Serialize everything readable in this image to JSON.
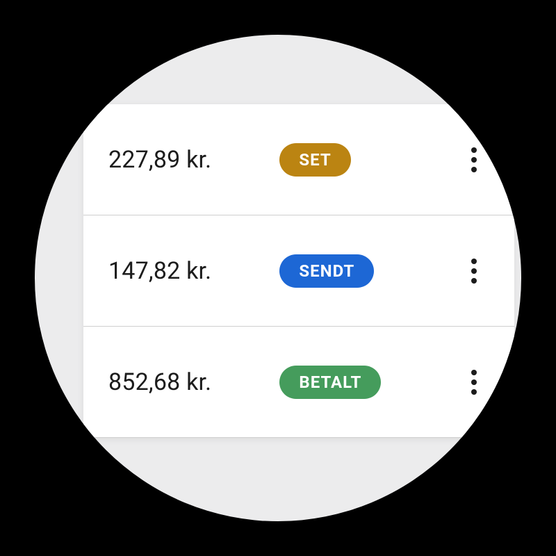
{
  "colors": {
    "status_set": "#bb8412",
    "status_sendt": "#1d67d5",
    "status_betalt": "#459c5c"
  },
  "rows": [
    {
      "amount": "227,89 kr.",
      "status_label": "SET",
      "status_color_key": "status_set"
    },
    {
      "amount": "147,82 kr.",
      "status_label": "SENDT",
      "status_color_key": "status_sendt"
    },
    {
      "amount": "852,68 kr.",
      "status_label": "BETALT",
      "status_color_key": "status_betalt"
    }
  ]
}
